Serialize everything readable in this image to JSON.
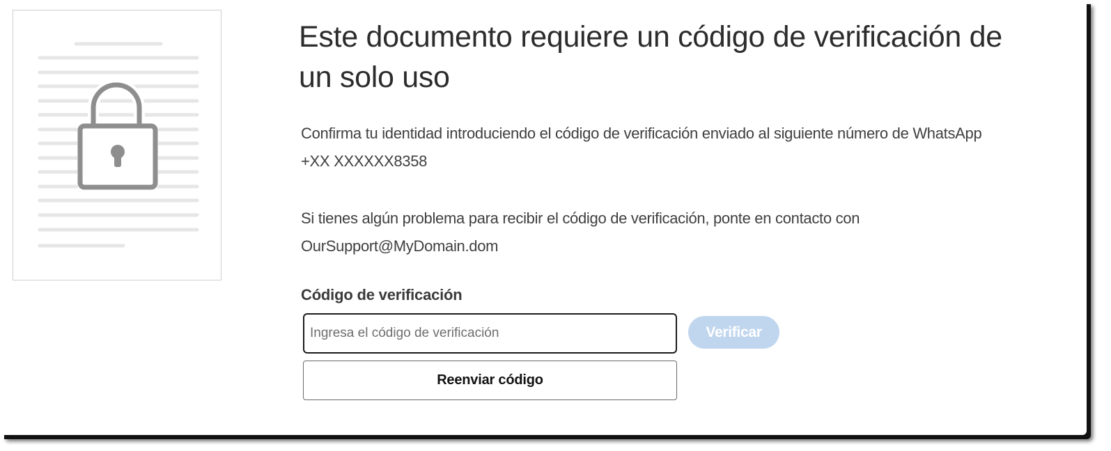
{
  "page": {
    "title": "Este documento requiere un código de verificación de un solo uso",
    "identity_message": "Confirma tu identidad introduciendo el código de verificación enviado al siguiente número de WhatsApp +XX XXXXXX8358",
    "support_message": "Si tienes algún problema para recibir el código de verificación, ponte en contacto con OurSupport@MyDomain.dom"
  },
  "form": {
    "field_label": "Código de verificación",
    "code_value": "",
    "code_placeholder": "Ingresa el código de verificación",
    "verify_label": "Verificar",
    "resend_label": "Reenviar código"
  },
  "icons": {
    "document": "document-icon",
    "lock": "lock-icon"
  },
  "colors": {
    "verify_disabled": "#c0d6ee",
    "text": "#3f3f3f",
    "thumbnail_lines": "#e6e6e6",
    "lock": "#8e8e8e"
  }
}
